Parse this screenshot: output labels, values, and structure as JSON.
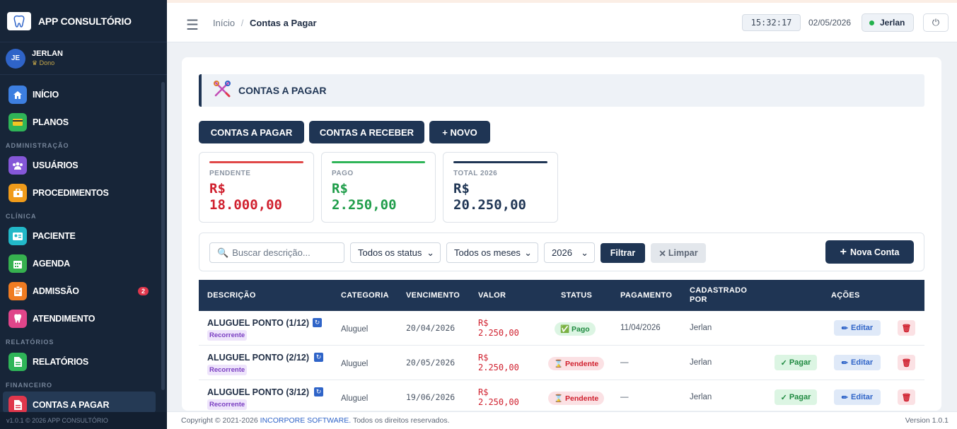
{
  "app": {
    "name": "APP CONSULTÓRIO",
    "version_footer": "v1.0.1 © 2026 APP CONSULTÓRIO"
  },
  "user": {
    "initials": "JE",
    "name": "JERLAN",
    "role": "Dono"
  },
  "menu": {
    "items": [
      {
        "label": "INÍCIO",
        "icon": "home-icon",
        "color": "#3d7fe0"
      },
      {
        "label": "PLANOS",
        "icon": "card-icon",
        "color": "#2fb558"
      },
      {
        "label": "USUÁRIOS",
        "icon": "users-icon",
        "color": "#8557d8"
      },
      {
        "label": "PROCEDIMENTOS",
        "icon": "briefcase-icon",
        "color": "#f09b1a"
      },
      {
        "label": "PACIENTE",
        "icon": "id-card-icon",
        "color": "#22b8c8"
      },
      {
        "label": "AGENDA",
        "icon": "calendar-icon",
        "color": "#36b14f"
      },
      {
        "label": "ADMISSÃO",
        "icon": "clipboard-icon",
        "color": "#f07c22"
      },
      {
        "label": "ATENDIMENTO",
        "icon": "tooth-icon",
        "color": "#e0458a"
      },
      {
        "label": "RELATÓRIOS",
        "icon": "document-icon",
        "color": "#2fb558"
      },
      {
        "label": "CONTAS A PAGAR",
        "icon": "document-icon",
        "color": "#e0374c"
      }
    ],
    "sections": [
      "ADMINISTRAÇÃO",
      "CLÍNICA",
      "RELATÓRIOS",
      "FINANCEIRO"
    ],
    "admissao_badge": "2"
  },
  "topbar": {
    "breadcrumb_home": "Início",
    "breadcrumb_sep": "/",
    "breadcrumb_current": "Contas a Pagar",
    "clock": "15:32:17",
    "date": "02/05/2026",
    "user": "Jerlan"
  },
  "page": {
    "title": "CONTAS A PAGAR",
    "buttons": [
      "CONTAS A PAGAR",
      "CONTAS A RECEBER",
      "+ NOVO"
    ]
  },
  "stats": [
    {
      "label": "PENDENTE",
      "currency": "R$",
      "value": "18.000,00",
      "color": "#d0202e"
    },
    {
      "label": "PAGO",
      "currency": "R$",
      "value": "2.250,00",
      "color": "#1f9d4a"
    },
    {
      "label": "TOTAL 2026",
      "currency": "R$",
      "value": "20.250,00",
      "color": "#1f3554"
    }
  ],
  "filters": {
    "search_placeholder": "Buscar descrição...",
    "status": "Todos os status",
    "month": "Todos os meses",
    "year": "2026",
    "filter_btn": "Filtrar",
    "clear_btn": "Limpar",
    "new_btn": "Nova Conta"
  },
  "table": {
    "headers": [
      "DESCRIÇÃO",
      "CATEGORIA",
      "VENCIMENTO",
      "VALOR",
      "STATUS",
      "PAGAMENTO",
      "CADASTRADO",
      "POR",
      "AÇÕES"
    ],
    "rows": [
      {
        "desc": "ALUGUEL PONTO (1/12)",
        "tag": "Recorrente",
        "category": "Aluguel",
        "due": "20/04/2026",
        "currency": "R$",
        "value": "2.250,00",
        "status": "Pago",
        "paid": "11/04/2026",
        "by": "Jerlan",
        "pay_btn": "",
        "edit": "Editar"
      },
      {
        "desc": "ALUGUEL PONTO (2/12)",
        "tag": "Recorrente",
        "category": "Aluguel",
        "due": "20/05/2026",
        "currency": "R$",
        "value": "2.250,00",
        "status": "Pendente",
        "paid": "—",
        "by": "Jerlan",
        "pay_btn": "Pagar",
        "edit": "Editar"
      },
      {
        "desc": "ALUGUEL PONTO (3/12)",
        "tag": "Recorrente",
        "category": "Aluguel",
        "due": "19/06/2026",
        "currency": "R$",
        "value": "2.250,00",
        "status": "Pendente",
        "paid": "—",
        "by": "Jerlan",
        "pay_btn": "Pagar",
        "edit": "Editar"
      }
    ]
  },
  "footer": {
    "copyright": "Copyright © 2021-2026",
    "company": "INCORPORE SOFTWARE.",
    "rights": "Todos os direitos reservados.",
    "version": "Version 1.0.1"
  }
}
